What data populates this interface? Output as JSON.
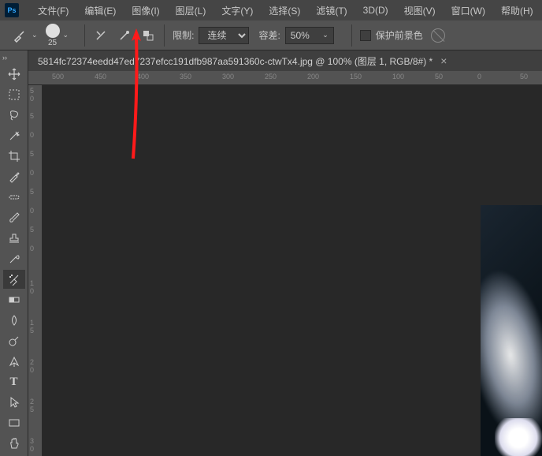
{
  "menubar": {
    "items": [
      "文件(F)",
      "编辑(E)",
      "图像(I)",
      "图层(L)",
      "文字(Y)",
      "选择(S)",
      "滤镜(T)",
      "3D(D)",
      "视图(V)",
      "窗口(W)",
      "帮助(H)"
    ]
  },
  "optbar": {
    "brush_size": "25",
    "limit_label": "限制:",
    "limit_value": "连续",
    "tolerance_label": "容差:",
    "tolerance_value": "50%",
    "protect_label": "保护前景色"
  },
  "tab": {
    "title": "5814fc72374eedd47ed7237efcc191dfb987aa591360c-ctwTx4.jpg @ 100% (图层 1, RGB/8#) *"
  },
  "ruler_h": [
    "500",
    "450",
    "400",
    "350",
    "300",
    "250",
    "200",
    "150",
    "100",
    "50",
    "0",
    "50"
  ],
  "ruler_v": [
    "5",
    "0",
    "5",
    "0",
    "5",
    "0",
    "5",
    "0",
    "5",
    "0",
    "1",
    "0",
    "1",
    "5",
    "2",
    "0",
    "2",
    "5",
    "3",
    "0"
  ],
  "tools": [
    "move",
    "marquee",
    "lasso",
    "magic-wand",
    "crop",
    "eyedropper",
    "heal",
    "brush",
    "stamp",
    "history-brush",
    "eraser-bg",
    "gradient",
    "blur",
    "dodge",
    "pen",
    "type",
    "path-select",
    "rectangle",
    "hand"
  ]
}
